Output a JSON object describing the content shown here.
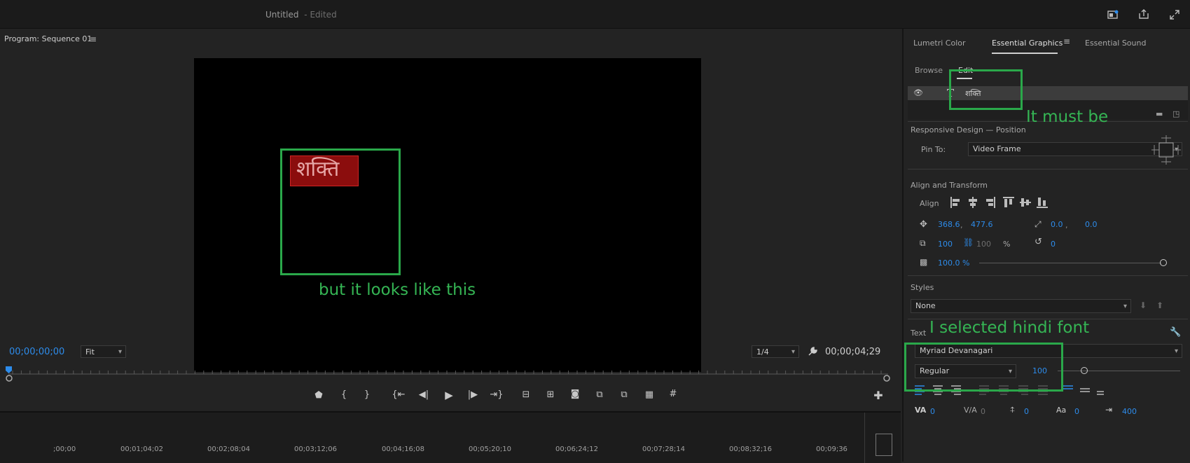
{
  "titlebar": {
    "doc_name": "Untitled",
    "status": "- Edited"
  },
  "monitor": {
    "title": "Program: Sequence 01",
    "text_overlay": "शक्ति",
    "timecode_current": "00;00;00;00",
    "zoom": "Fit",
    "resolution": "1/4",
    "timecode_duration": "00;00;04;29"
  },
  "timeline": {
    "ticks": [
      ";00;00",
      "00;01;04;02",
      "00;02;08;04",
      "00;03;12;06",
      "00;04;16;08",
      "00;05;20;10",
      "00;06;24;12",
      "00;07;28;14",
      "00;08;32;16",
      "00;09;36"
    ]
  },
  "panel": {
    "tabs": [
      "Lumetri Color",
      "Essential Graphics",
      "Essential Sound"
    ],
    "subtabs": [
      "Browse",
      "Edit"
    ],
    "layer_name": "शक्ति",
    "responsive": {
      "header": "Responsive Design — Position",
      "pin_label": "Pin To:",
      "pin_value": "Video Frame"
    },
    "align": {
      "header": "Align and Transform",
      "label": "Align",
      "pos_x": "368.6",
      "pos_y": "477.6",
      "anchor_x": "0.0",
      "anchor_y": "0.0",
      "scale": "100",
      "scale_linked": "100",
      "scale_unit": "%",
      "rotation": "0",
      "opacity": "100.0 %"
    },
    "styles": {
      "header": "Styles",
      "value": "None"
    },
    "text": {
      "header": "Text",
      "font": "Myriad Devanagari",
      "weight": "Regular",
      "size": "100",
      "kerning": "0",
      "tracking": "0",
      "baseline": "0",
      "tsume": "0",
      "tab_width": "400"
    }
  },
  "annotations": {
    "must_be": "It must be",
    "looks_like": "but it looks like this",
    "selected": "I selected hindi font"
  },
  "colors": {
    "accent": "#2d8ceb",
    "annotation": "#2aa84a",
    "selection": "#8b0d0d"
  }
}
